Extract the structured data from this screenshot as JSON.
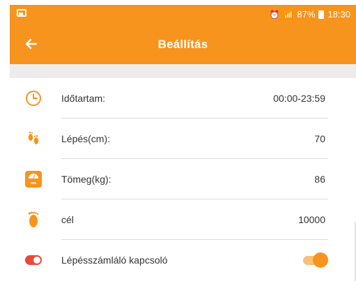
{
  "status_bar": {
    "battery": "87%",
    "time": "18:30"
  },
  "app_bar": {
    "title": "Beállítás"
  },
  "settings": {
    "items": [
      {
        "icon": "clock-icon",
        "label": "Időtartam:",
        "value": "00:00-23:59"
      },
      {
        "icon": "footprints-icon",
        "label": "Lépés(cm):",
        "value": "70"
      },
      {
        "icon": "scale-icon",
        "label": "Tömeg(kg):",
        "value": "86"
      },
      {
        "icon": "foot-icon",
        "label": "cél",
        "value": "10000"
      },
      {
        "icon": "switch-icon",
        "label": "Lépésszámláló kapcsoló",
        "toggle_on": true
      }
    ]
  },
  "colors": {
    "accent": "#f7941d",
    "icon_red": "#e64a3c",
    "toggle_track": "#f9c07a"
  }
}
